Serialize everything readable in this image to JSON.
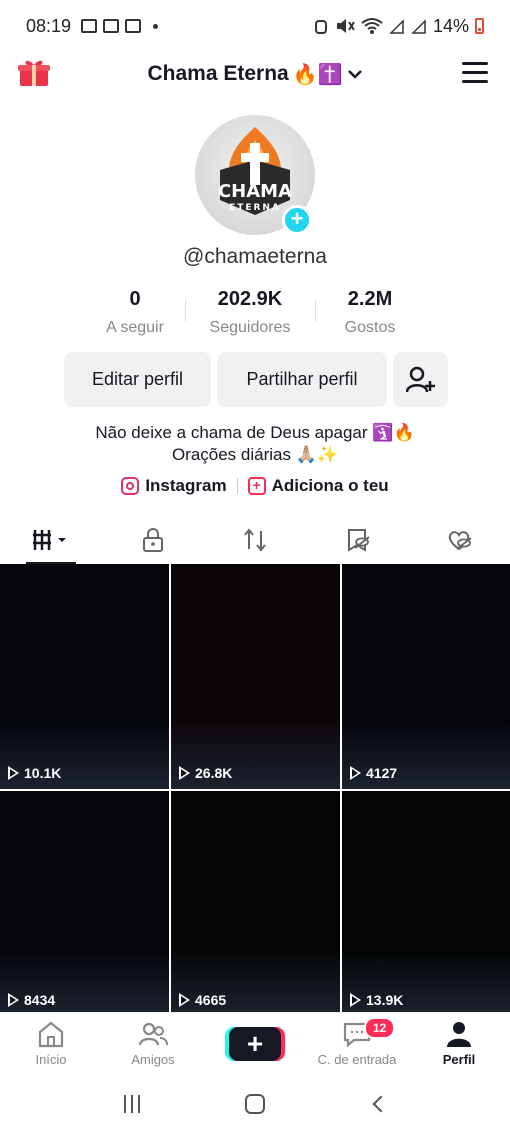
{
  "status_bar": {
    "time": "08:19",
    "battery": "14%"
  },
  "header": {
    "title": "Chama Eterna",
    "title_emojis": "🔥✝️"
  },
  "profile": {
    "username": "@chamaeterna",
    "avatar_text_top": "CHAMA",
    "avatar_text_bottom": "ETERNA"
  },
  "stats": [
    {
      "value": "0",
      "label": "A seguir"
    },
    {
      "value": "202.9K",
      "label": "Seguidores"
    },
    {
      "value": "2.2M",
      "label": "Gostos"
    }
  ],
  "buttons": {
    "edit": "Editar perfil",
    "share": "Partilhar perfil"
  },
  "bio": {
    "line1": "Não deixe a chama de Deus apagar 🛐🔥",
    "line2": "Orações diárias 🙏🏼✨"
  },
  "links": {
    "instagram": "Instagram",
    "add": "Adiciona o teu"
  },
  "videos": [
    {
      "views": "10.1K",
      "color": "#05070d"
    },
    {
      "views": "26.8K",
      "color": "#0b0609"
    },
    {
      "views": "4127",
      "color": "#05070c"
    },
    {
      "views": "8434",
      "color": "#05060b"
    },
    {
      "views": "4665",
      "color": "#040604"
    },
    {
      "views": "13.9K",
      "color": "#030504"
    }
  ],
  "bottom_nav": [
    {
      "label": "Início"
    },
    {
      "label": "Amigos"
    },
    {
      "label": ""
    },
    {
      "label": "C. de entrada",
      "badge": "12"
    },
    {
      "label": "Perfil"
    }
  ],
  "colors": {
    "accent_cyan": "#20d5ec",
    "accent_red": "#fe2c55",
    "text_dark": "#161823"
  }
}
